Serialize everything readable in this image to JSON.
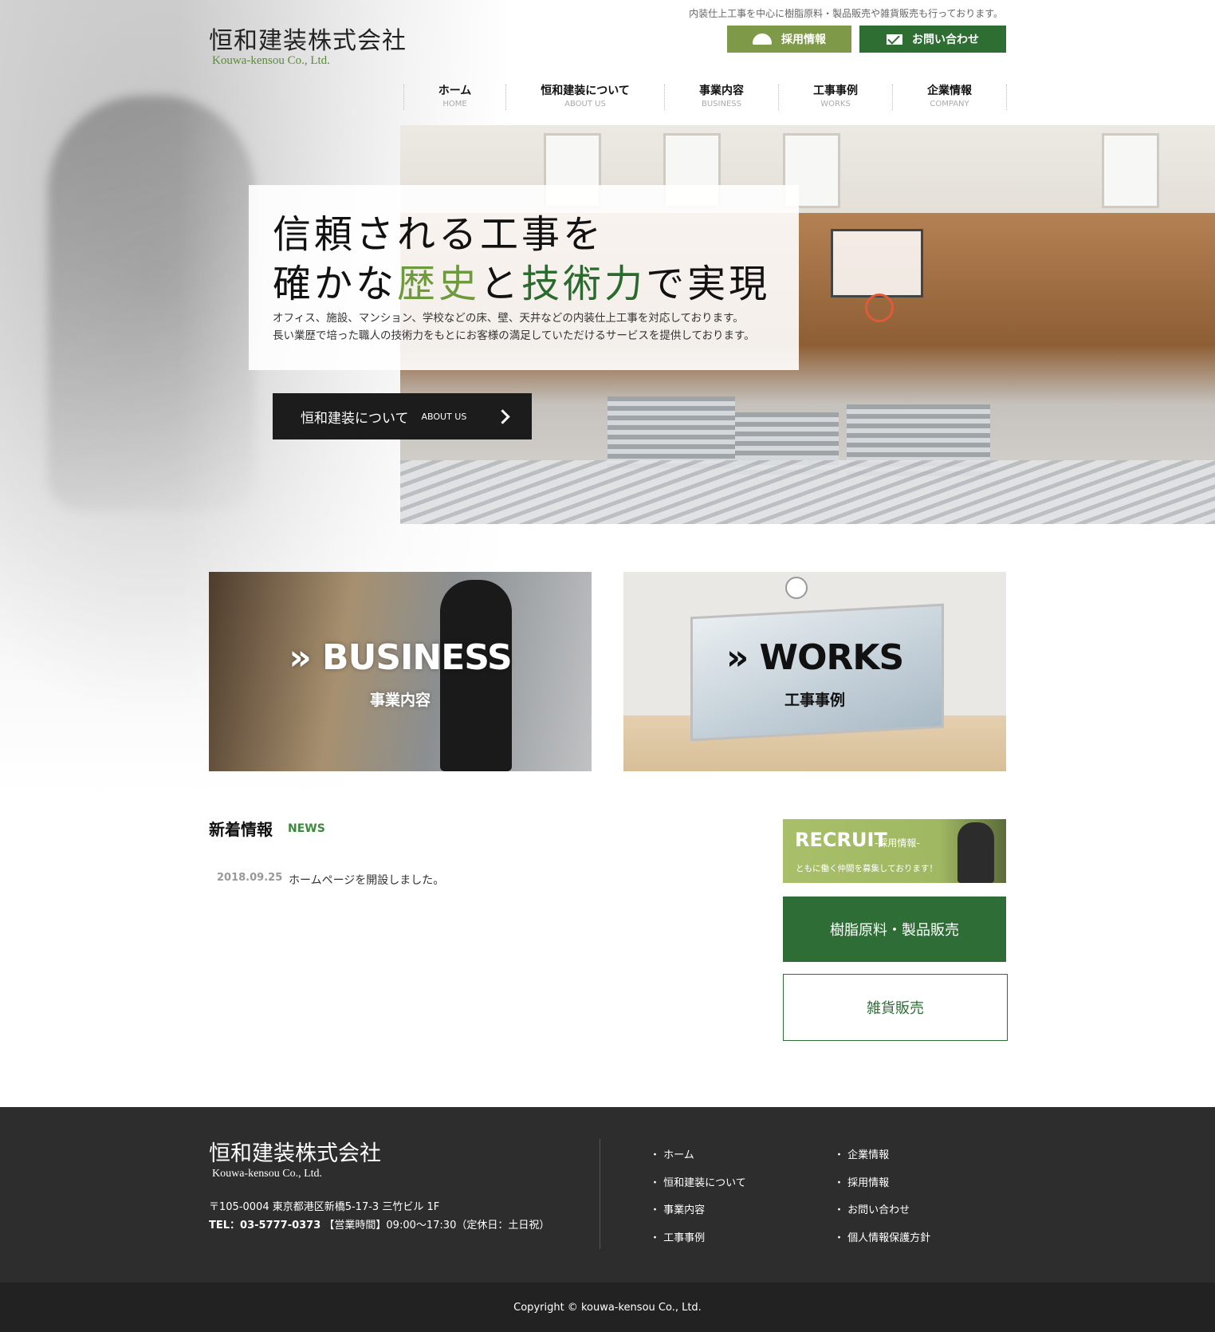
{
  "header": {
    "logo_jp": "恒和建装株式会社",
    "logo_en": "Kouwa-kensou Co., Ltd.",
    "tagline": "内装仕上工事を中心に樹脂原料・製品販売や雑貨販売も行っております。",
    "recruit_label": "採用情報",
    "contact_label": "お問い合わせ"
  },
  "nav": [
    {
      "jp": "ホーム",
      "en": "HOME"
    },
    {
      "jp": "恒和建装について",
      "en": "ABOUT US"
    },
    {
      "jp": "事業内容",
      "en": "BUSINESS"
    },
    {
      "jp": "工事事例",
      "en": "WORKS"
    },
    {
      "jp": "企業情報",
      "en": "COMPANY"
    }
  ],
  "hero": {
    "line1": "信頼される工事を",
    "line2_a": "確かな",
    "line2_b": "歴史",
    "line2_c": "と",
    "line2_d": "技術力",
    "line2_e": "で実現",
    "desc1": "オフィス、施設、マンション、学校などの床、壁、天井などの内装仕上工事を対応しております。",
    "desc2": "長い業歴で培った職人の技術力をもとにお客様の満足していただけるサービスを提供しております。",
    "about_jp": "恒和建装について",
    "about_en": "ABOUT US"
  },
  "banners": {
    "business_title": "» BUSINESS",
    "business_sub": "事業内容",
    "works_title": "» WORKS",
    "works_sub": "工事事例"
  },
  "news": {
    "title": "新着情報",
    "title_en": "NEWS",
    "items": [
      {
        "date": "2018.09.25",
        "text": "ホームページを開設しました。"
      }
    ]
  },
  "side": {
    "recruit_title": "RECRUIT",
    "recruit_sub": "-採用情報-",
    "recruit_desc": "ともに働く仲間を募集しております！",
    "resin": "樹脂原料・製品販売",
    "goods": "雑貨販売"
  },
  "footer": {
    "logo_jp": "恒和建装株式会社",
    "logo_en": "Kouwa-kensou Co., Ltd.",
    "address": "〒105-0004 東京都港区新橋5-17-3 三竹ビル 1F",
    "tel": "TEL：03-5777-0373",
    "hours": " 【営業時間】09:00〜17:30（定休日：土日祝）",
    "links_col1": [
      "・ ホーム",
      "・ 恒和建装について",
      "・ 事業内容",
      "・ 工事事例"
    ],
    "links_col2": [
      "・ 企業情報",
      "・ 採用情報",
      "・ お問い合わせ",
      "・ 個人情報保護方針"
    ],
    "copyright": "Copyright © kouwa-kensou Co., Ltd."
  },
  "colors": {
    "accent_light_green": "#7e9a48",
    "accent_dark_green": "#2e6e32",
    "footer_bg": "#2d2d2d"
  }
}
